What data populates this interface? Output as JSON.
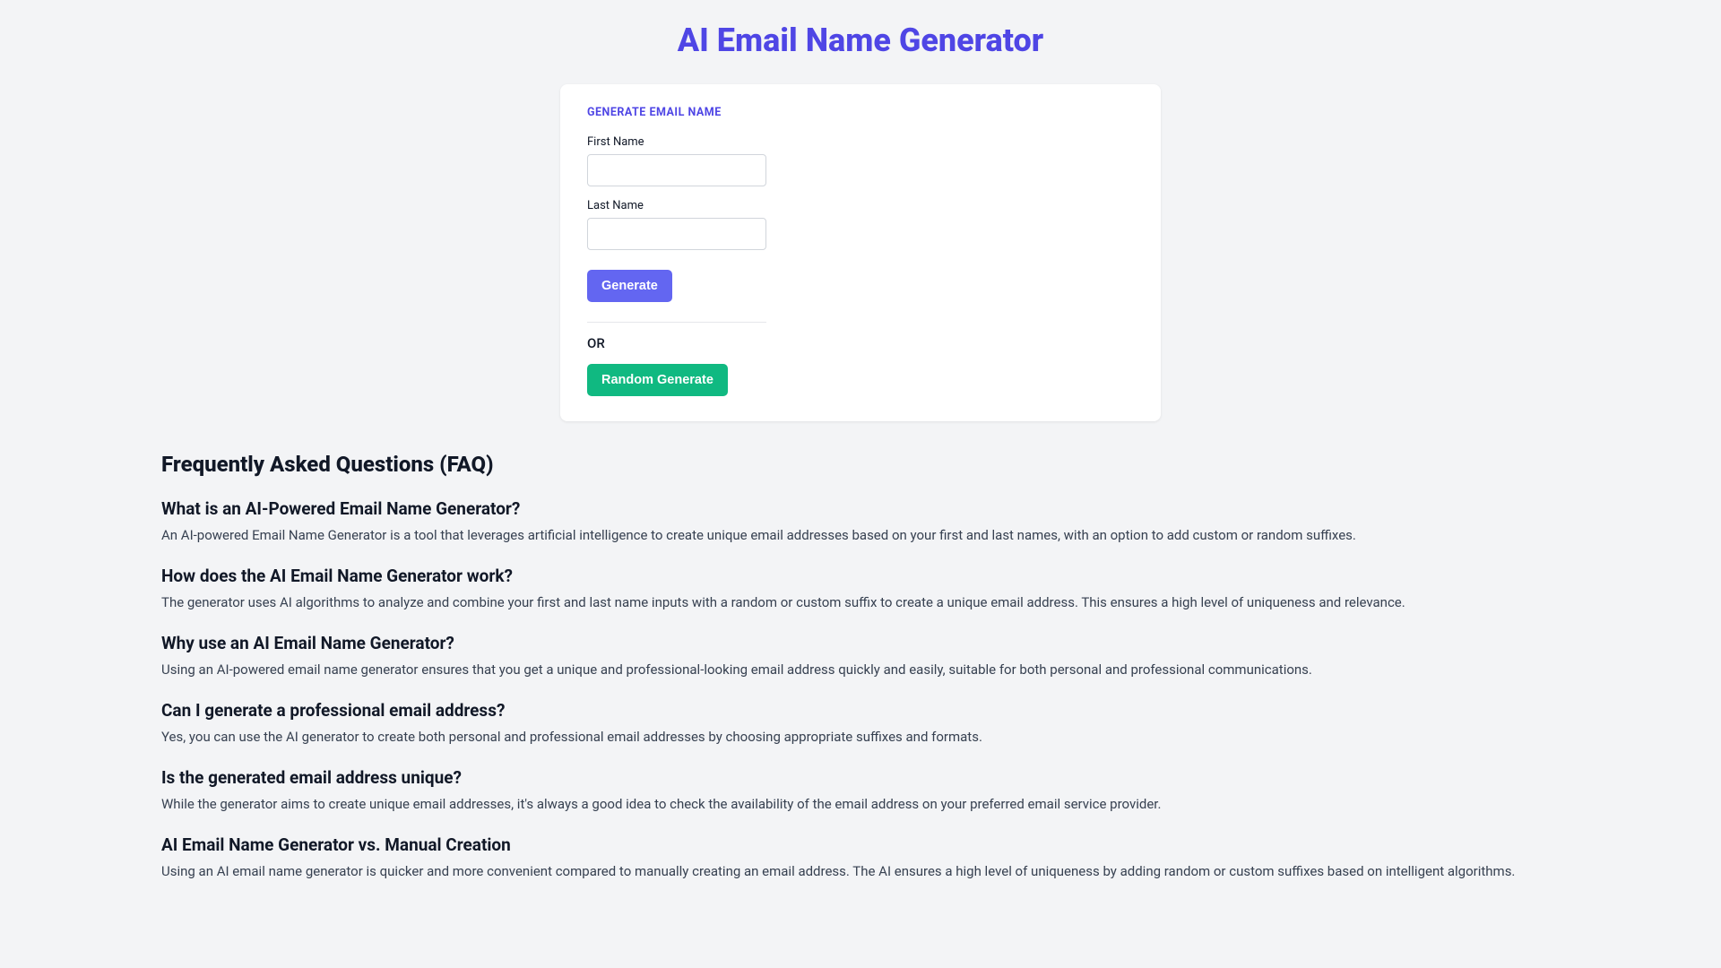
{
  "page": {
    "title": "AI Email Name Generator"
  },
  "form": {
    "heading": "GENERATE EMAIL NAME",
    "firstNameLabel": "First Name",
    "firstNameValue": "",
    "lastNameLabel": "Last Name",
    "lastNameValue": "",
    "generateLabel": "Generate",
    "orLabel": "OR",
    "randomGenerateLabel": "Random Generate"
  },
  "faq": {
    "title": "Frequently Asked Questions (FAQ)",
    "items": [
      {
        "q": "What is an AI-Powered Email Name Generator?",
        "a": "An AI-powered Email Name Generator is a tool that leverages artificial intelligence to create unique email addresses based on your first and last names, with an option to add custom or random suffixes."
      },
      {
        "q": "How does the AI Email Name Generator work?",
        "a": "The generator uses AI algorithms to analyze and combine your first and last name inputs with a random or custom suffix to create a unique email address. This ensures a high level of uniqueness and relevance."
      },
      {
        "q": "Why use an AI Email Name Generator?",
        "a": "Using an AI-powered email name generator ensures that you get a unique and professional-looking email address quickly and easily, suitable for both personal and professional communications."
      },
      {
        "q": "Can I generate a professional email address?",
        "a": "Yes, you can use the AI generator to create both personal and professional email addresses by choosing appropriate suffixes and formats."
      },
      {
        "q": "Is the generated email address unique?",
        "a": "While the generator aims to create unique email addresses, it's always a good idea to check the availability of the email address on your preferred email service provider."
      },
      {
        "q": "AI Email Name Generator vs. Manual Creation",
        "a": "Using an AI email name generator is quicker and more convenient compared to manually creating an email address. The AI ensures a high level of uniqueness by adding random or custom suffixes based on intelligent algorithms."
      }
    ]
  }
}
